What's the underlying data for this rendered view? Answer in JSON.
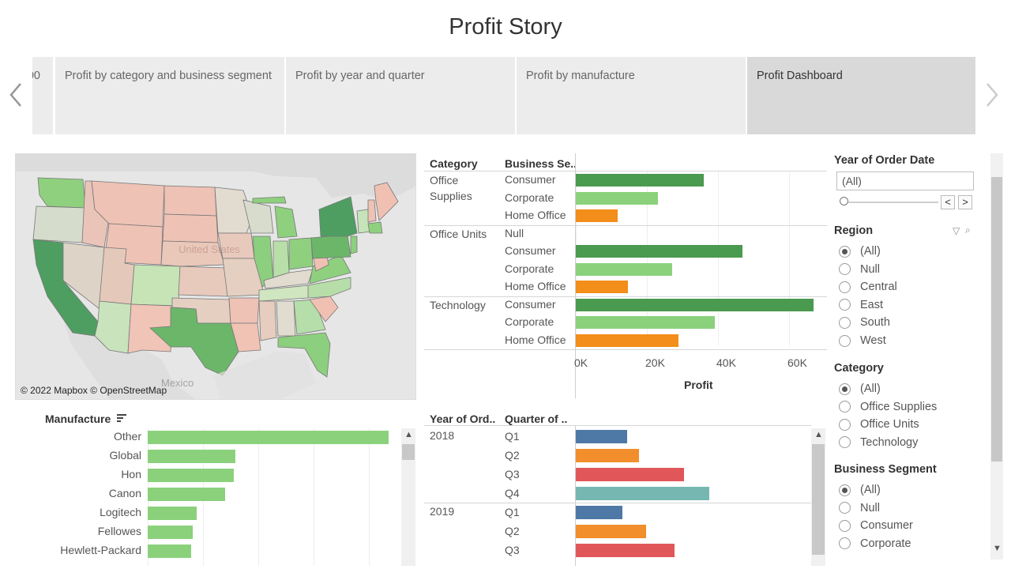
{
  "title": "Profit Story",
  "story_tabs": [
    {
      "label": "00",
      "active": false
    },
    {
      "label": "Profit by category and business segment",
      "active": false
    },
    {
      "label": "Profit by year and quarter",
      "active": false
    },
    {
      "label": "Profit by manufacture",
      "active": false
    },
    {
      "label": "Profit Dashboard",
      "active": true
    }
  ],
  "map": {
    "credit": "© 2022 Mapbox © OpenStreetMap",
    "country_label": "United States",
    "mexico_label": "Mexico"
  },
  "colors": {
    "dark_green": "#4a9a4f",
    "light_green": "#8bd17c",
    "orange": "#f28e19",
    "blue": "#4e79a7",
    "orange2": "#f28e2b",
    "red": "#e15759",
    "teal": "#76b7b2"
  },
  "category_chart": {
    "headers": {
      "category": "Category",
      "segment": "Business Se.."
    },
    "x_ticks": [
      "0K",
      "20K",
      "40K",
      "60K"
    ],
    "x_title": "Profit",
    "groups": [
      {
        "category": "Office Supplies",
        "rows": [
          {
            "segment": "Consumer",
            "value": 36000,
            "color": "dark_green"
          },
          {
            "segment": "Corporate",
            "value": 23000,
            "color": "light_green"
          },
          {
            "segment": "Home Office",
            "value": 11800,
            "color": "orange"
          }
        ]
      },
      {
        "category": "Office Units",
        "rows": [
          {
            "segment": "Null",
            "value": 0,
            "color": "light_green"
          },
          {
            "segment": "Consumer",
            "value": 46800,
            "color": "dark_green"
          },
          {
            "segment": "Corporate",
            "value": 27000,
            "color": "light_green"
          },
          {
            "segment": "Home Office",
            "value": 14600,
            "color": "orange"
          }
        ]
      },
      {
        "category": "Technology",
        "rows": [
          {
            "segment": "Consumer",
            "value": 66800,
            "color": "dark_green"
          },
          {
            "segment": "Corporate",
            "value": 39000,
            "color": "light_green"
          },
          {
            "segment": "Home Office",
            "value": 28800,
            "color": "orange"
          }
        ]
      }
    ]
  },
  "manufacture_chart": {
    "header": "Manufacture",
    "items": [
      {
        "label": "Other",
        "value": 100
      },
      {
        "label": "Global",
        "value": 36.5
      },
      {
        "label": "Hon",
        "value": 35.8
      },
      {
        "label": "Canon",
        "value": 32.2
      },
      {
        "label": "Logitech",
        "value": 20.3
      },
      {
        "label": "Fellowes",
        "value": 18.6
      },
      {
        "label": "Hewlett-Packard",
        "value": 18.1
      }
    ]
  },
  "year_chart": {
    "headers": {
      "year": "Year of Ord..",
      "quarter": "Quarter of .."
    },
    "groups": [
      {
        "year": "2018",
        "rows": [
          {
            "quarter": "Q1",
            "value": 22,
            "color": "blue"
          },
          {
            "quarter": "Q2",
            "value": 27,
            "color": "orange2"
          },
          {
            "quarter": "Q3",
            "value": 46,
            "color": "red"
          },
          {
            "quarter": "Q4",
            "value": 57,
            "color": "teal"
          }
        ]
      },
      {
        "year": "2019",
        "rows": [
          {
            "quarter": "Q1",
            "value": 20,
            "color": "blue"
          },
          {
            "quarter": "Q2",
            "value": 30,
            "color": "orange2"
          },
          {
            "quarter": "Q3",
            "value": 42,
            "color": "red"
          }
        ]
      }
    ]
  },
  "filters": {
    "year": {
      "title": "Year of Order Date",
      "value": "(All)",
      "prev": "<",
      "next": ">"
    },
    "region": {
      "title": "Region",
      "options": [
        "(All)",
        "Null",
        "Central",
        "East",
        "South",
        "West"
      ],
      "selected": "(All)"
    },
    "category": {
      "title": "Category",
      "options": [
        "(All)",
        "Office Supplies",
        "Office Units",
        "Technology"
      ],
      "selected": "(All)"
    },
    "segment": {
      "title": "Business Segment",
      "options": [
        "(All)",
        "Null",
        "Consumer",
        "Corporate"
      ],
      "selected": "(All)"
    }
  }
}
